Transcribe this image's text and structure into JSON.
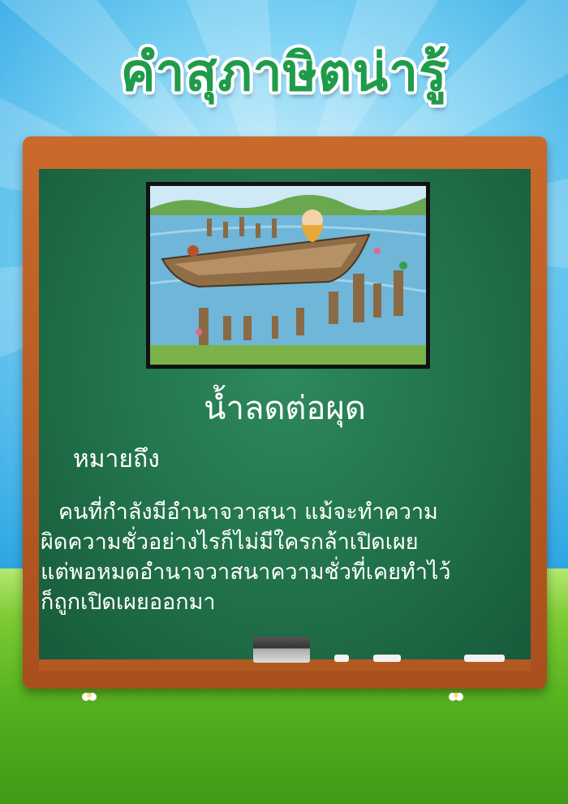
{
  "title": "คำสุภาษิตน่ารู้",
  "proverb": "น้ำลดต่อผุด",
  "meaning_label": "หมายถึง",
  "meaning_lines": [
    "คนที่กำลังมีอำนาจวาสนา แม้จะทำความ",
    "ผิดความชั่วอย่างไรก็ไม่มีใครกล้าเปิดเผย",
    "แต่พอหมดอำนาจวาสนาความชั่วที่เคยทำไว้",
    "ก็ถูกเปิดเผยออกมา"
  ],
  "colors": {
    "title": "#1f9b4a",
    "board": "#1f6e47",
    "frame": "#b85a22",
    "sky": "#2fa7e4",
    "grass": "#56b21f"
  }
}
